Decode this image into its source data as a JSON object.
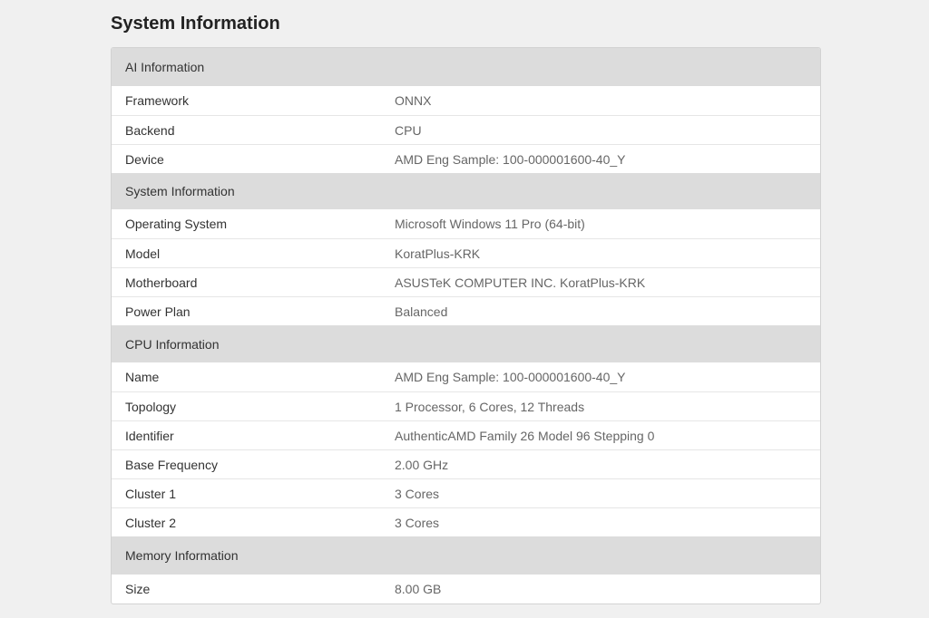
{
  "page_title": "System Information",
  "sections": [
    {
      "title": "AI Information",
      "rows": [
        {
          "label": "Framework",
          "value": "ONNX"
        },
        {
          "label": "Backend",
          "value": "CPU"
        },
        {
          "label": "Device",
          "value": "AMD Eng Sample: 100-000001600-40_Y"
        }
      ]
    },
    {
      "title": "System Information",
      "rows": [
        {
          "label": "Operating System",
          "value": "Microsoft Windows 11 Pro (64-bit)"
        },
        {
          "label": "Model",
          "value": "KoratPlus-KRK"
        },
        {
          "label": "Motherboard",
          "value": "ASUSTeK COMPUTER INC. KoratPlus-KRK"
        },
        {
          "label": "Power Plan",
          "value": "Balanced"
        }
      ]
    },
    {
      "title": "CPU Information",
      "rows": [
        {
          "label": "Name",
          "value": "AMD Eng Sample: 100-000001600-40_Y"
        },
        {
          "label": "Topology",
          "value": "1 Processor, 6 Cores, 12 Threads"
        },
        {
          "label": "Identifier",
          "value": "AuthenticAMD Family 26 Model 96 Stepping 0"
        },
        {
          "label": "Base Frequency",
          "value": "2.00 GHz"
        },
        {
          "label": "Cluster 1",
          "value": "3 Cores"
        },
        {
          "label": "Cluster 2",
          "value": "3 Cores"
        }
      ]
    },
    {
      "title": "Memory Information",
      "rows": [
        {
          "label": "Size",
          "value": "8.00 GB"
        }
      ]
    }
  ]
}
